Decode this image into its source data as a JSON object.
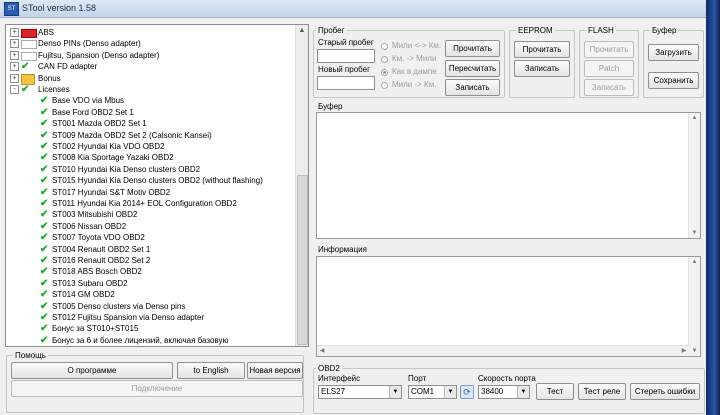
{
  "window": {
    "title": "STool version 1.58",
    "icon": "stool-app-icon"
  },
  "tree": {
    "items": [
      {
        "label": "ABS",
        "level": 0,
        "expander": "+",
        "icon": "abs-logo-icon",
        "checked": false
      },
      {
        "label": "Denso PINs (Denso adapter)",
        "level": 0,
        "expander": "+",
        "icon": "denso-logo-icon",
        "checked": false
      },
      {
        "label": "Fujitsu, Spansion (Denso adapter)",
        "level": 0,
        "expander": "+",
        "icon": "fujitsu-logo-icon",
        "checked": false
      },
      {
        "label": "CAN FD adapter",
        "level": 0,
        "expander": "+",
        "icon": "check-icon",
        "checked": true
      },
      {
        "label": "Bonus",
        "level": 0,
        "expander": "+",
        "icon": "folder-icon",
        "checked": false
      },
      {
        "label": "Licenses",
        "level": 0,
        "expander": "-",
        "icon": "check-icon",
        "checked": true
      },
      {
        "label": "Base VDO via Mbus",
        "level": 1,
        "checked": true
      },
      {
        "label": "Base Ford OBD2 Set 1",
        "level": 1,
        "checked": true
      },
      {
        "label": "ST001 Mazda OBD2 Set 1",
        "level": 1,
        "checked": true
      },
      {
        "label": "ST009 Mazda OBD2 Set 2 (Calsonic Kansei)",
        "level": 1,
        "checked": true
      },
      {
        "label": "ST002 Hyundai Kia VDO OBD2",
        "level": 1,
        "checked": true
      },
      {
        "label": "ST008 Kia Sportage Yazaki OBD2",
        "level": 1,
        "checked": true
      },
      {
        "label": "ST010 Hyundai Kia Denso clusters OBD2",
        "level": 1,
        "checked": true
      },
      {
        "label": "ST015 Hyundai Kia Denso clusters OBD2 (without flashing)",
        "level": 1,
        "checked": true
      },
      {
        "label": "ST017 Hyundai S&T Motiv OBD2",
        "level": 1,
        "checked": true
      },
      {
        "label": "ST011 Hyundai Kia 2014+ EOL Configuration OBD2",
        "level": 1,
        "checked": true
      },
      {
        "label": "ST003 Mitsubishi OBD2",
        "level": 1,
        "checked": true
      },
      {
        "label": "ST006 Nissan OBD2",
        "level": 1,
        "checked": true
      },
      {
        "label": "ST007 Toyota VDO OBD2",
        "level": 1,
        "checked": true
      },
      {
        "label": "ST004 Renault OBD2 Set 1",
        "level": 1,
        "checked": true
      },
      {
        "label": "ST016 Renault OBD2 Set 2",
        "level": 1,
        "checked": true
      },
      {
        "label": "ST018 ABS Bosch OBD2",
        "level": 1,
        "checked": true
      },
      {
        "label": "ST013 Subaru OBD2",
        "level": 1,
        "checked": true
      },
      {
        "label": "ST014 GM OBD2",
        "level": 1,
        "checked": true
      },
      {
        "label": "ST005 Denso clusters via Denso pins",
        "level": 1,
        "checked": true
      },
      {
        "label": "ST012 Fujitsu Spansion via Denso adapter",
        "level": 1,
        "checked": true
      },
      {
        "label": "Бонус за ST010+ST015",
        "level": 1,
        "checked": true
      },
      {
        "label": "Бонус за 6 и более лицензий, включая базовую",
        "level": 1,
        "checked": true
      }
    ]
  },
  "help": {
    "title": "Помощь",
    "about": "О программе",
    "english": "to English",
    "new_version": "Новая версия",
    "connect": "Подключение"
  },
  "mileage": {
    "title": "Пробег",
    "old_label": "Старый пробег",
    "new_label": "Новый пробег",
    "old_value": "",
    "new_value": "",
    "radio1": "Мили <-> Км.",
    "radio2": "Км. -> Мили",
    "radio3": "Как в дампе",
    "radio4": "Мили -> Км.",
    "read": "Прочитать",
    "recalc": "Пересчитать",
    "write": "Записать"
  },
  "eeprom": {
    "title": "EEPROM",
    "read": "Прочитать",
    "write": "Записать"
  },
  "flash": {
    "title": "FLASH",
    "read": "Прочитать",
    "patch": "Patch",
    "write": "Записать"
  },
  "buffer_group": {
    "title": "Буфер",
    "load": "Загрузить",
    "save": "Сохранить"
  },
  "buffer_memo": {
    "title": "Буфер",
    "content": ""
  },
  "info_memo": {
    "title": "Информация",
    "content": ""
  },
  "obd2": {
    "title": "OBD2",
    "interface_label": "Интерфейс",
    "interface_value": "ELS27",
    "port_label": "Порт",
    "port_value": "COM1",
    "speed_label": "Скорость порта",
    "speed_value": "38400",
    "test": "Тест",
    "relay_test": "Тест реле",
    "erase_errors": "Стереть ошибки"
  },
  "colors": {
    "check": "#1eac2f",
    "desktop": "#1d3a78"
  }
}
